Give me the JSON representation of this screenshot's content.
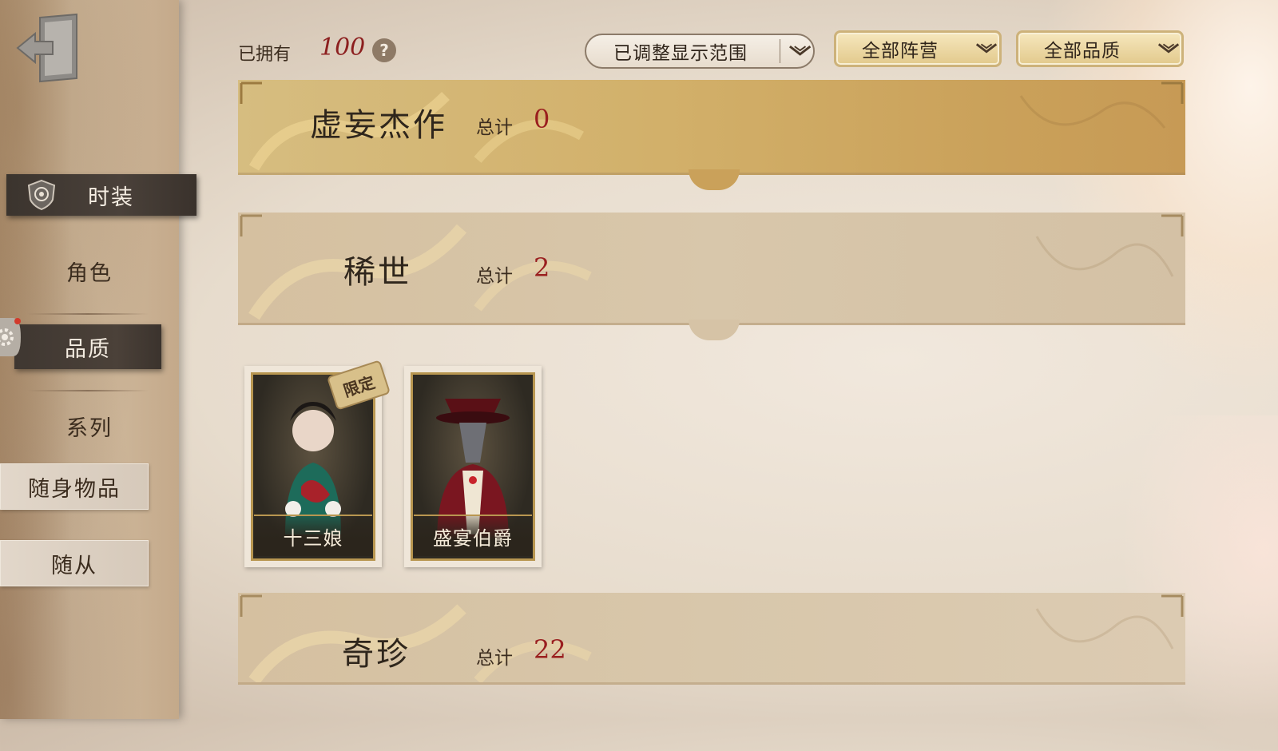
{
  "sidebar": {
    "exit_icon": "exit-door-icon",
    "items": [
      {
        "label": "时装",
        "icon": "shield-emblem-icon"
      },
      {
        "label": "角色"
      },
      {
        "label": "品质"
      },
      {
        "label": "系列"
      },
      {
        "label": "随身物品"
      },
      {
        "label": "随从"
      }
    ]
  },
  "topbar": {
    "owned_label": "已拥有",
    "owned_value": "100",
    "help_icon": "?",
    "range_filter": "已调整显示范围",
    "camp_filter": "全部阵营",
    "quality_filter": "全部品质"
  },
  "categories": [
    {
      "title": "虚妄杰作",
      "total_label": "总计",
      "total": "0"
    },
    {
      "title": "稀世",
      "total_label": "总计",
      "total": "2"
    },
    {
      "title": "奇珍",
      "total_label": "总计",
      "total": "22"
    }
  ],
  "skins": [
    {
      "name": "十三娘",
      "tag": "限定"
    },
    {
      "name": "盛宴伯爵"
    }
  ],
  "colors": {
    "accent_red": "#9a1f1f",
    "gold": "#cdb27a",
    "dark_tab": "#3f3731"
  }
}
